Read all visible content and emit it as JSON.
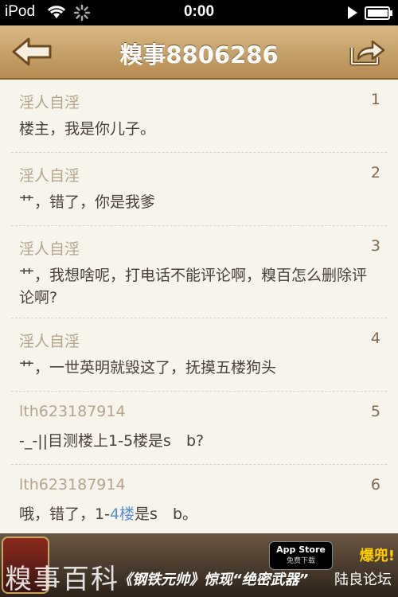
{
  "status_bar": {
    "carrier": "iPod",
    "time": "0:00"
  },
  "nav": {
    "title": "糗事8806286",
    "back": "back",
    "share": "share"
  },
  "comments": [
    {
      "user": "淫人自淫",
      "floor": "1",
      "text": "楼主，我是你儿子。"
    },
    {
      "user": "淫人自淫",
      "floor": "2",
      "text": "艹，错了，你是我爹"
    },
    {
      "user": "淫人自淫",
      "floor": "3",
      "text": "艹，我想啥呢，打电话不能评论啊，糗百怎么删除评论啊?"
    },
    {
      "user": "淫人自淫",
      "floor": "4",
      "text": "艹，一世英明就毁这了，抚摸五楼狗头"
    },
    {
      "user": "lth623187914",
      "floor": "5",
      "text": "-_-||目测楼上1-5楼是s　b?"
    },
    {
      "user": "lth623187914",
      "floor": "6",
      "text_pre": "哦，错了，1-",
      "text_link": "4楼",
      "text_post": "是s　b。"
    }
  ],
  "ad": {
    "watermark": "糗事百科",
    "copy": "《钢铁元帅》惊现“绝密武器”",
    "appstore_line1": "App Store",
    "appstore_line2": "免费下载",
    "forum": "陆良论坛",
    "pop": "爆兜!"
  },
  "colors": {
    "nav_top": "#d7b986",
    "nav_bottom": "#b58b52",
    "user": "#b3a48b",
    "link": "#5a8fd0"
  }
}
